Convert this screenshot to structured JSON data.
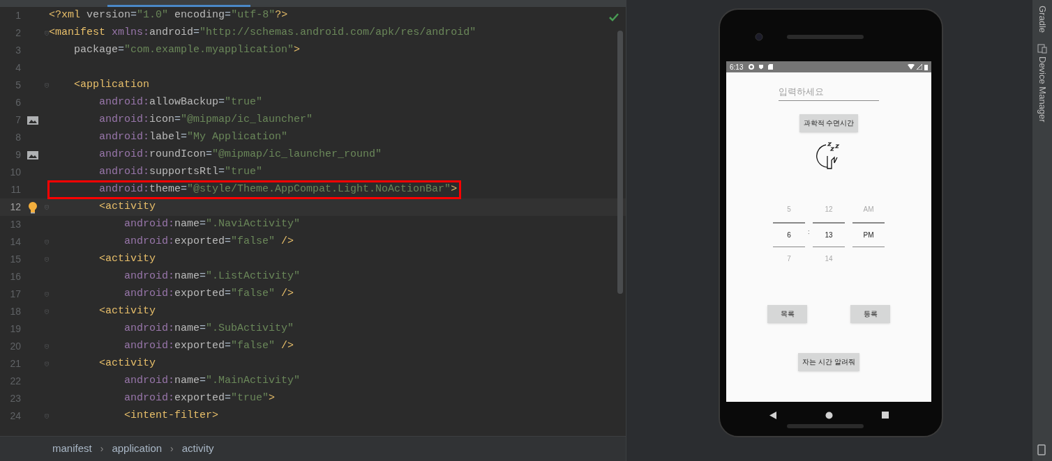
{
  "editor": {
    "lines": [
      {
        "number": "1",
        "text": "<?xml version=\"1.0\" encoding=\"utf-8\"?>"
      },
      {
        "number": "2",
        "text": "<manifest xmlns:android=\"http://schemas.android.com/apk/res/android\"",
        "fold": true
      },
      {
        "number": "3",
        "text": "    package=\"com.example.myapplication\">"
      },
      {
        "number": "4"
      },
      {
        "number": "5",
        "text": "    <application",
        "fold": true
      },
      {
        "number": "6",
        "text": "        android:allowBackup=\"true\""
      },
      {
        "number": "7",
        "text": "        android:icon=\"@mipmap/ic_launcher\"",
        "kind": "image"
      },
      {
        "number": "8",
        "text": "        android:label=\"My Application\""
      },
      {
        "number": "9",
        "text": "        android:roundIcon=\"@mipmap/ic_launcher_round\"",
        "kind": "image"
      },
      {
        "number": "10",
        "text": "        android:supportsRtl=\"true\""
      },
      {
        "number": "11",
        "text": "        android:theme=\"@style/Theme.AppCompat.Light.NoActionBar\">",
        "boxed": true
      },
      {
        "number": "12",
        "text": "        <activity",
        "kind": "bulb",
        "current": true,
        "fold": true
      },
      {
        "number": "13",
        "text": "            android:name=\".NaviActivity\""
      },
      {
        "number": "14",
        "text": "            android:exported=\"false\" />",
        "fold": true
      },
      {
        "number": "15",
        "text": "        <activity",
        "fold": true
      },
      {
        "number": "16",
        "text": "            android:name=\".ListActivity\""
      },
      {
        "number": "17",
        "text": "            android:exported=\"false\" />",
        "fold": true
      },
      {
        "number": "18",
        "text": "        <activity",
        "fold": true
      },
      {
        "number": "19",
        "text": "            android:name=\".SubActivity\""
      },
      {
        "number": "20",
        "text": "            android:exported=\"false\" />",
        "fold": true
      },
      {
        "number": "21",
        "text": "        <activity",
        "fold": true
      },
      {
        "number": "22",
        "text": "            android:name=\".MainActivity\""
      },
      {
        "number": "23",
        "text": "            android:exported=\"true\">"
      },
      {
        "number": "24",
        "text": "            <intent-filter>",
        "fold": true
      }
    ]
  },
  "breadcrumb": {
    "separator": "›",
    "items": [
      "manifest",
      "application",
      "activity"
    ]
  },
  "right_toolbar": [
    "Gradle",
    "Device Manager"
  ],
  "phone": {
    "status_bar": {
      "time": "6:13"
    },
    "input": {
      "placeholder": "입력하세요"
    },
    "top_button": "과학적 수면시간",
    "picker": {
      "separator": ":",
      "columns": [
        {
          "items": [
            {
              "text": "5",
              "selected": false
            },
            {
              "text": "6",
              "selected": true
            },
            {
              "text": "7",
              "selected": false
            }
          ]
        },
        {
          "items": [
            {
              "text": "12",
              "selected": false
            },
            {
              "text": "13",
              "selected": true
            },
            {
              "text": "14",
              "selected": false
            }
          ]
        },
        {
          "items": [
            {
              "text": "AM",
              "selected": false
            },
            {
              "text": "PM",
              "selected": true
            }
          ]
        }
      ]
    },
    "buttons": [
      "목록",
      "등록"
    ],
    "bottom_button": "자는 시간 알려줘"
  }
}
